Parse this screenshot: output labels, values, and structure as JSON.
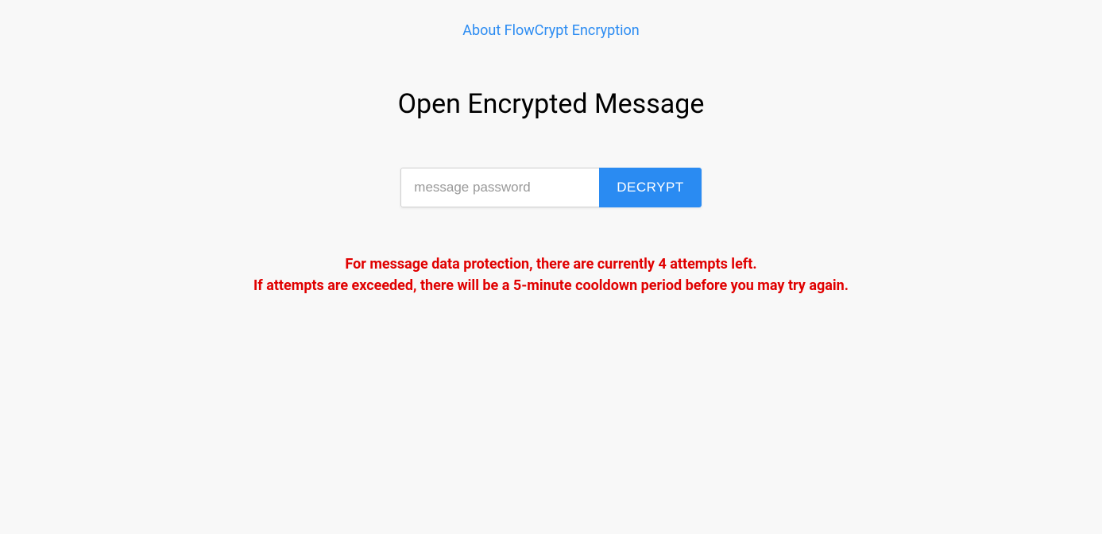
{
  "header": {
    "about_link_text": "About FlowCrypt Encryption"
  },
  "main": {
    "title": "Open Encrypted Message",
    "password_placeholder": "message password",
    "decrypt_button_label": "DECRYPT"
  },
  "warning": {
    "line1": "For message data protection, there are currently 4 attempts left.",
    "line2": "If attempts are exceeded, there will be a 5-minute cooldown period before you may try again."
  }
}
